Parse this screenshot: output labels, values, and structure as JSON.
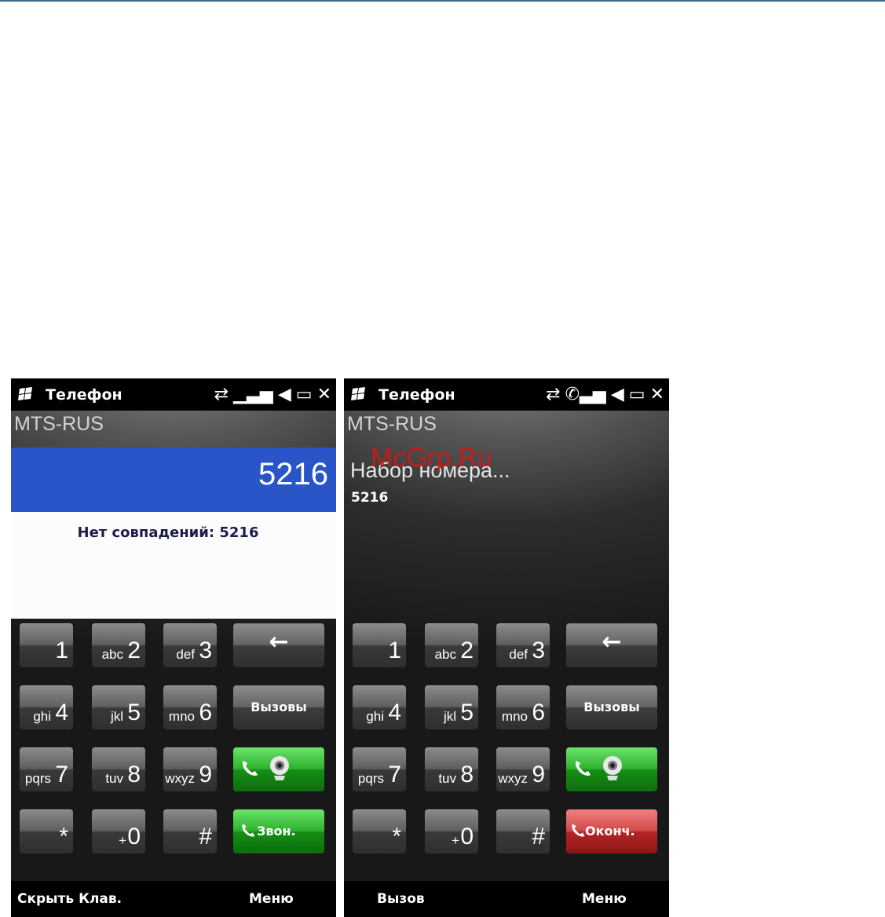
{
  "left": {
    "title": "Телефон",
    "operator": "MTS-RUS",
    "number": "5216",
    "no_match": "Нет совпадений: 5216",
    "keys": [
      {
        "digit": "1",
        "letters": ""
      },
      {
        "digit": "2",
        "letters": "abc"
      },
      {
        "digit": "3",
        "letters": "def"
      },
      {
        "digit": "4",
        "letters": "ghi"
      },
      {
        "digit": "5",
        "letters": "jkl"
      },
      {
        "digit": "6",
        "letters": "mno"
      },
      {
        "digit": "7",
        "letters": "pqrs"
      },
      {
        "digit": "8",
        "letters": "tuv"
      },
      {
        "digit": "9",
        "letters": "wxyz"
      },
      {
        "digit": "*",
        "letters": ""
      },
      {
        "digit": "0",
        "letters": "+"
      },
      {
        "digit": "#",
        "letters": ""
      }
    ],
    "backspace": "←",
    "calls": "Вызовы",
    "call": "Звон.",
    "soft_left": "Скрыть Клав.",
    "soft_right": "Меню"
  },
  "right": {
    "title": "Телефон",
    "operator": "MTS-RUS",
    "dialing": "Набор номера...",
    "number": "5216",
    "keys": [
      {
        "digit": "1",
        "letters": ""
      },
      {
        "digit": "2",
        "letters": "abc"
      },
      {
        "digit": "3",
        "letters": "def"
      },
      {
        "digit": "4",
        "letters": "ghi"
      },
      {
        "digit": "5",
        "letters": "jkl"
      },
      {
        "digit": "6",
        "letters": "mno"
      },
      {
        "digit": "7",
        "letters": "pqrs"
      },
      {
        "digit": "8",
        "letters": "tuv"
      },
      {
        "digit": "9",
        "letters": "wxyz"
      },
      {
        "digit": "*",
        "letters": ""
      },
      {
        "digit": "0",
        "letters": "+"
      },
      {
        "digit": "#",
        "letters": ""
      }
    ],
    "backspace": "←",
    "calls": "Вызовы",
    "end": "Оконч.",
    "soft_left": "Вызов",
    "soft_right": "Меню"
  },
  "watermark": "McGrp.Ru",
  "icons": [
    "windows-start-icon",
    "data-connection-icon",
    "signal-icon",
    "speaker-icon",
    "battery-icon",
    "close-icon",
    "phone-icon",
    "webcam-icon"
  ],
  "colors": {
    "number_bar": "#2a55c9",
    "call_green": "#2fb22f",
    "end_red": "#d24a4a"
  }
}
